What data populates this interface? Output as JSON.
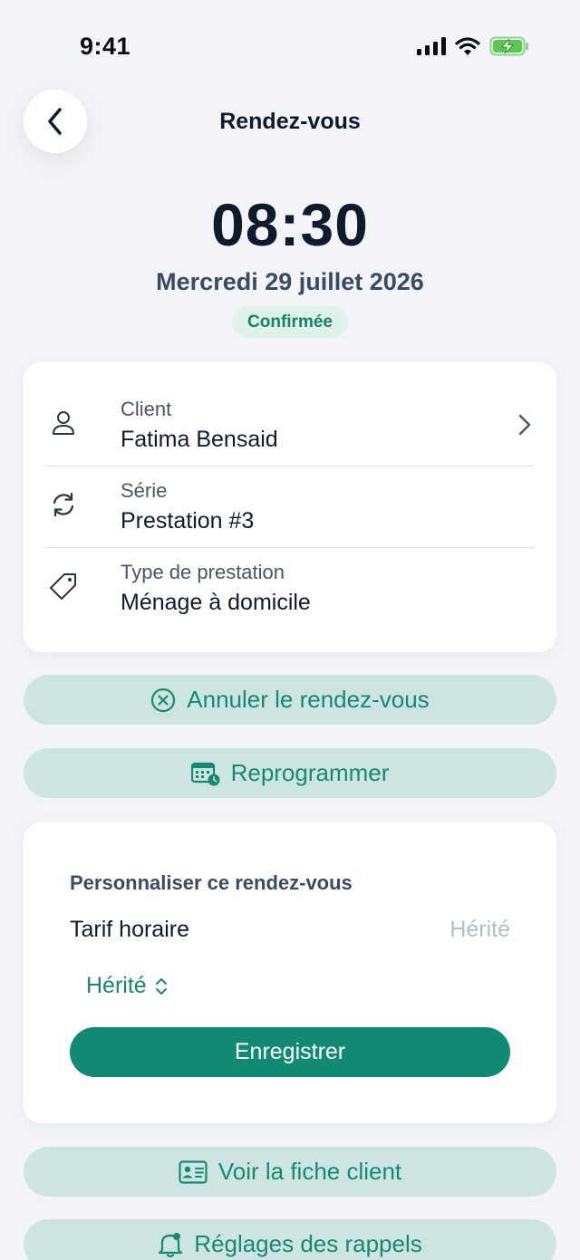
{
  "status_bar": {
    "time": "9:41"
  },
  "header": {
    "title": "Rendez-vous",
    "back_icon": "chevron-left-icon"
  },
  "appointment": {
    "time": "08:30",
    "date": "Mercredi 29 juillet 2026",
    "status": "Confirmée"
  },
  "details": {
    "client": {
      "label": "Client",
      "value": "Fatima Bensaid",
      "icon": "person-icon"
    },
    "series": {
      "label": "Série",
      "value": "Prestation #3",
      "icon": "refresh-icon"
    },
    "service_type": {
      "label": "Type de prestation",
      "value": "Ménage à domicile",
      "icon": "tag-icon"
    }
  },
  "actions": {
    "cancel_label": "Annuler le rendez-vous",
    "reschedule_label": "Reprogrammer",
    "client_file_label": "Voir la fiche client",
    "reminders_label": "Réglages des rappels"
  },
  "customize": {
    "title": "Personnaliser ce rendez-vous",
    "rate_label": "Tarif horaire",
    "rate_placeholder": "Hérité",
    "picker_value": "Hérité",
    "save_label": "Enregistrer"
  },
  "colors": {
    "accent": "#108a72",
    "accent_text": "#178a6e",
    "soft_button": "#cde5e2",
    "badge_bg": "#dff2ea",
    "background": "#f2f4f7"
  }
}
